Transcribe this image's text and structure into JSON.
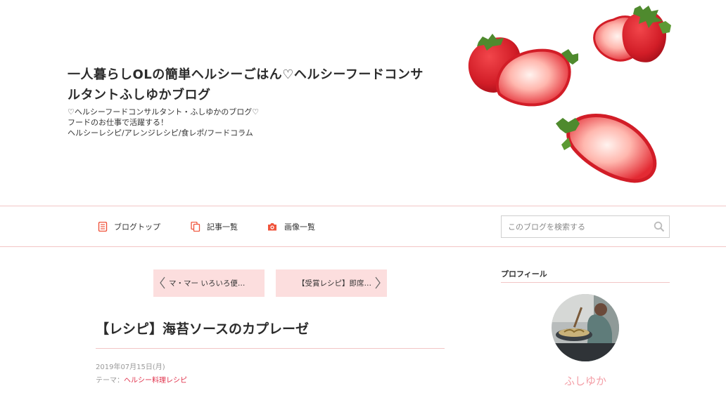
{
  "header": {
    "title": "一人暮らしOLの簡単ヘルシーごはん♡ヘルシーフードコンサルタントふしゆかブログ",
    "description": [
      "♡ヘルシーフードコンサルタント・ふしゆかのブログ♡",
      "フードのお仕事で活躍する！",
      "ヘルシーレシピ/アレンジレシピ/食レポ/フードコラム"
    ]
  },
  "nav": {
    "blog_top": "ブログトップ",
    "articles": "記事一覧",
    "images": "画像一覧",
    "search_placeholder": "このブログを検索する",
    "icon_color": "#f0543c"
  },
  "pager": {
    "prev": "マ・マー いろいろ便…",
    "next": "【受賞レシピ】即席…"
  },
  "article": {
    "title": "【レシピ】海苔ソースのカプレーゼ",
    "date": "2019年07月15日(月)",
    "theme_label": "テーマ：",
    "theme": "ヘルシー料理レシピ"
  },
  "sidebar": {
    "profile_heading": "プロフィール",
    "profile_name": "ふしゆか"
  },
  "colors": {
    "accent_pink": "#fcdede",
    "divider": "#f2c5c5",
    "link_red": "#e0304a",
    "name_pink": "#f4a0a8"
  }
}
